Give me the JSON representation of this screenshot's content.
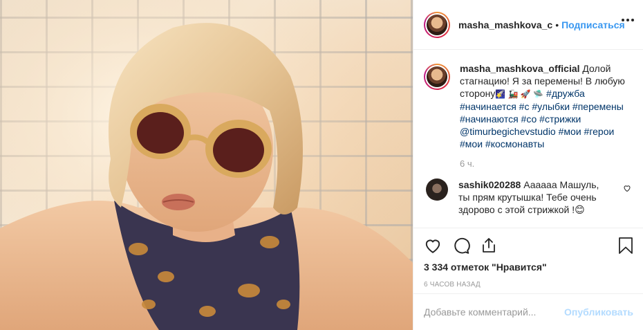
{
  "header": {
    "username": "masha_mashkova_c",
    "separator": "•",
    "follow_label": "Подписаться",
    "more_icon": "more-dots-icon"
  },
  "caption": {
    "username": "masha_mashkova_official",
    "text_1": "Долой стагнацию! Я за перемены! В любую сторону",
    "emojis": "🌠 🚂 🚀 🛸",
    "tags_1": "#дружба #начинается #с #улыбки #перемены #начинаются #со #стрижки",
    "mention": "@timurbegichevstudio",
    "tags_2": "#мои #герои #мои #космонавты",
    "time": "6 ч."
  },
  "comment": {
    "username": "sashik020288",
    "text": "Аааааа Машуль, ты прям крутышка! Тебе очень здорово с этой стрижкой !",
    "emoji": "😊",
    "heart_icon": "heart-outline-icon"
  },
  "actions": {
    "like_icon": "heart-icon",
    "comment_icon": "comment-icon",
    "share_icon": "share-icon",
    "save_icon": "bookmark-icon",
    "likes_text": "3 334 отметок \"Нравится\"",
    "posted_ago": "6 ЧАСОВ НАЗАД"
  },
  "add_comment": {
    "placeholder": "Добавьте комментарий...",
    "publish_label": "Опубликовать"
  },
  "colors": {
    "link_blue": "#3897f0",
    "hashtag": "#003569",
    "muted": "#999999",
    "publish_disabled": "#b3dbff"
  }
}
